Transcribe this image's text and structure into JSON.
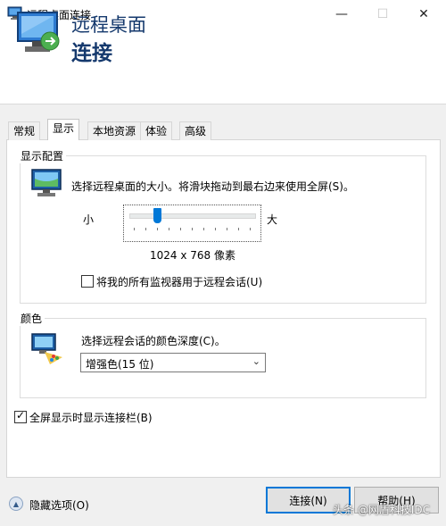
{
  "window": {
    "title": "远程桌面连接",
    "minimize_icon": "—",
    "maximize_icon": "☐",
    "close_icon": "✕"
  },
  "banner": {
    "line1": "远程桌面",
    "line2": "连接"
  },
  "tabs": [
    {
      "label": "常规",
      "active": false
    },
    {
      "label": "显示",
      "active": true
    },
    {
      "label": "本地资源",
      "active": false
    },
    {
      "label": "体验",
      "active": false
    },
    {
      "label": "高级",
      "active": false
    }
  ],
  "display_config": {
    "title": "显示配置",
    "description": "选择远程桌面的大小。将滑块拖动到最右边来使用全屏(S)。",
    "small_label": "小",
    "large_label": "大",
    "resolution": "1024 x 768 像素",
    "slider_level": 0.2,
    "all_monitors_label": "将我的所有监视器用于远程会话(U)",
    "all_monitors_checked": false
  },
  "colors": {
    "title": "颜色",
    "description": "选择远程会话的颜色深度(C)。",
    "selected": "增强色(15 位)"
  },
  "fullscreen_bar": {
    "label": "全屏显示时显示连接栏(B)",
    "checked": true,
    "check_glyph": "✓"
  },
  "footer": {
    "hide_options": "隐藏选项(O)",
    "toggle_glyph": "▲",
    "connect": "连接(N)",
    "help": "帮助(H)"
  },
  "watermark": "头条 @网盾科技IDC",
  "colors_theme": {
    "accent": "#0078d7",
    "banner_text": "#15396d"
  }
}
